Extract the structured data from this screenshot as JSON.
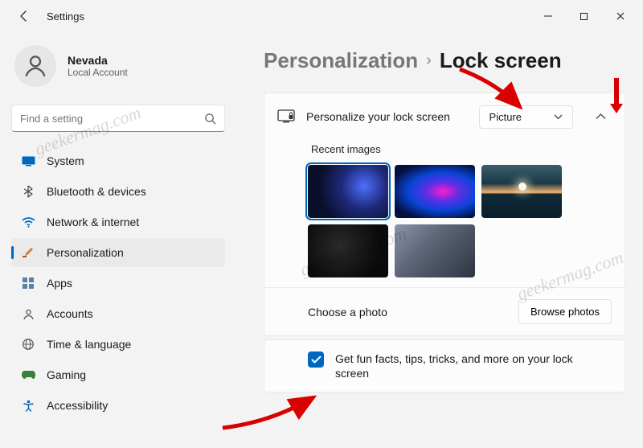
{
  "window": {
    "title": "Settings"
  },
  "user": {
    "name": "Nevada",
    "sub": "Local Account"
  },
  "search": {
    "placeholder": "Find a setting"
  },
  "nav": [
    {
      "label": "System"
    },
    {
      "label": "Bluetooth & devices"
    },
    {
      "label": "Network & internet"
    },
    {
      "label": "Personalization"
    },
    {
      "label": "Apps"
    },
    {
      "label": "Accounts"
    },
    {
      "label": "Time & language"
    },
    {
      "label": "Gaming"
    },
    {
      "label": "Accessibility"
    }
  ],
  "breadcrumb": {
    "parent": "Personalization",
    "current": "Lock screen"
  },
  "personalize": {
    "label": "Personalize your lock screen",
    "dropdown_value": "Picture",
    "recent_label": "Recent images",
    "choose_label": "Choose a photo",
    "browse_label": "Browse photos"
  },
  "funfacts": {
    "checked": true,
    "label": "Get fun facts, tips, tricks, and more on your lock screen"
  },
  "watermark": "geekermag.com"
}
